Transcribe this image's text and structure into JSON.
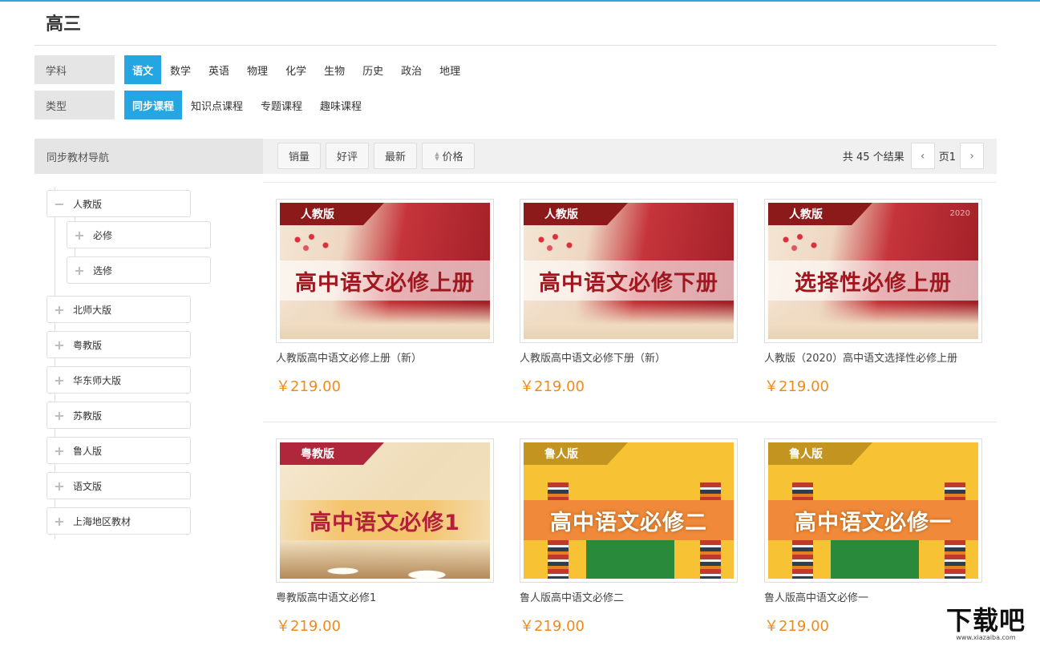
{
  "page": {
    "title": "高三"
  },
  "filters": {
    "subject": {
      "label": "学科",
      "options": [
        "语文",
        "数学",
        "英语",
        "物理",
        "化学",
        "生物",
        "历史",
        "政治",
        "地理"
      ],
      "active": "语文"
    },
    "type": {
      "label": "类型",
      "options": [
        "同步课程",
        "知识点课程",
        "专题课程",
        "趣味课程"
      ],
      "active": "同步课程"
    }
  },
  "sidebar": {
    "title": "同步教材导航",
    "tree": [
      {
        "label": "人教版",
        "toggle": "−",
        "children": [
          {
            "label": "必修",
            "toggle": "+"
          },
          {
            "label": "选修",
            "toggle": "+"
          }
        ]
      },
      {
        "label": "北师大版",
        "toggle": "+"
      },
      {
        "label": "粤教版",
        "toggle": "+"
      },
      {
        "label": "华东师大版",
        "toggle": "+"
      },
      {
        "label": "苏教版",
        "toggle": "+"
      },
      {
        "label": "鲁人版",
        "toggle": "+"
      },
      {
        "label": "语文版",
        "toggle": "+"
      },
      {
        "label": "上海地区教材",
        "toggle": "+"
      }
    ]
  },
  "sortbar": {
    "buttons": [
      "销量",
      "好评",
      "最新",
      "价格"
    ],
    "result_text": "共 45 个结果",
    "page_label": "页1",
    "prev_icon": "‹",
    "next_icon": "›"
  },
  "courses": [
    {
      "tag": "人教版",
      "cover_title": "高中语文必修上册",
      "year": "",
      "style": "red",
      "name": "人教版高中语文必修上册（新）",
      "price": "￥219.00"
    },
    {
      "tag": "人教版",
      "cover_title": "高中语文必修下册",
      "year": "",
      "style": "red",
      "name": "人教版高中语文必修下册（新）",
      "price": "￥219.00"
    },
    {
      "tag": "人教版",
      "cover_title": "选择性必修上册",
      "year": "2020",
      "style": "red",
      "name": "人教版（2020）高中语文选择性必修上册",
      "price": "￥219.00"
    },
    {
      "tag": "粤教版",
      "cover_title": "高中语文必修1",
      "year": "",
      "style": "yue",
      "name": "粤教版高中语文必修1",
      "price": "￥219.00"
    },
    {
      "tag": "鲁人版",
      "cover_title": "高中语文必修二",
      "year": "",
      "style": "lu",
      "name": "鲁人版高中语文必修二",
      "price": "￥219.00"
    },
    {
      "tag": "鲁人版",
      "cover_title": "高中语文必修一",
      "year": "",
      "style": "lu",
      "name": "鲁人版高中语文必修一",
      "price": "￥219.00"
    }
  ],
  "watermark": {
    "big": "下载吧",
    "small": "www.xiazaiba.com"
  },
  "colors": {
    "accent": "#23a6e2",
    "price": "#f08a1a",
    "topline": "#2fa7e0"
  }
}
